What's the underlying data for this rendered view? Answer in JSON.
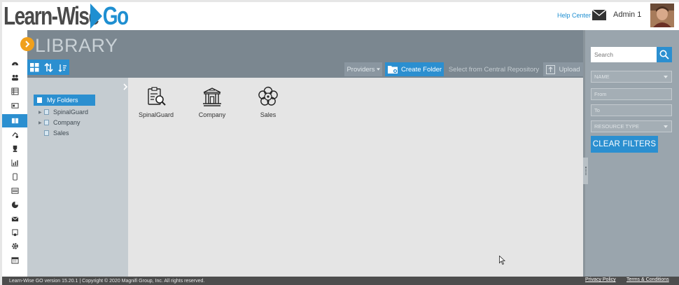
{
  "header": {
    "logo_main": "Learn-Wise ",
    "logo_accent": "Go",
    "help_center": "Help Center",
    "user_name": "Admin 1"
  },
  "library": {
    "title": "LIBRARY"
  },
  "toolbar": {
    "providers": "Providers",
    "create_folder": "Create Folder",
    "central_repository": "Select from Central Repository",
    "upload": "Upload"
  },
  "tree": {
    "root": "My Folders",
    "nodes": [
      "SpinalGuard",
      "Company",
      "Sales"
    ]
  },
  "folders": [
    {
      "label": "SpinalGuard",
      "icon": "clipboard-search-icon"
    },
    {
      "label": "Company",
      "icon": "building-icon"
    },
    {
      "label": "Sales",
      "icon": "flower-icon"
    }
  ],
  "filters": {
    "search_placeholder": "Search",
    "name": "NAME",
    "from": "From",
    "to": "To",
    "resource_type": "RESOURCE TYPE",
    "clear": "CLEAR FILTERS"
  },
  "footer": {
    "version": "Learn-Wise GO version 15.20.1 | Copyright © 2020 Magnifi Group, Inc. All rights reserved.",
    "privacy": "Privacy Policy",
    "terms": "Terms & Conditions"
  },
  "colors": {
    "accent": "#2b8fd0",
    "orange": "#f0a01c",
    "band": "#7b8790"
  }
}
